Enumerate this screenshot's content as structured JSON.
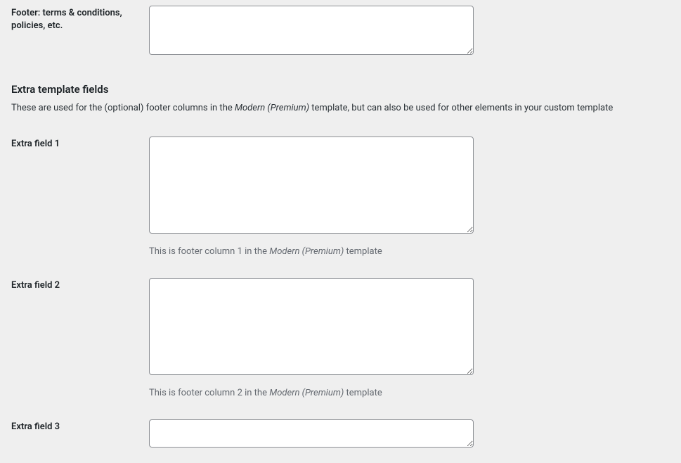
{
  "footer_field": {
    "label": "Footer: terms & conditions, policies, etc.",
    "value": ""
  },
  "extra_section": {
    "heading": "Extra template fields",
    "desc_before": "These are used for the (optional) footer columns in the ",
    "desc_em": "Modern (Premium)",
    "desc_after": " template, but can also be used for other elements in your custom template"
  },
  "extra_fields": {
    "f1": {
      "label": "Extra field 1",
      "value": "",
      "help_before": "This is footer column 1 in the ",
      "help_em": "Modern (Premium)",
      "help_after": " template"
    },
    "f2": {
      "label": "Extra field 2",
      "value": "",
      "help_before": "This is footer column 2 in the ",
      "help_em": "Modern (Premium)",
      "help_after": " template"
    },
    "f3": {
      "label": "Extra field 3",
      "value": ""
    }
  }
}
